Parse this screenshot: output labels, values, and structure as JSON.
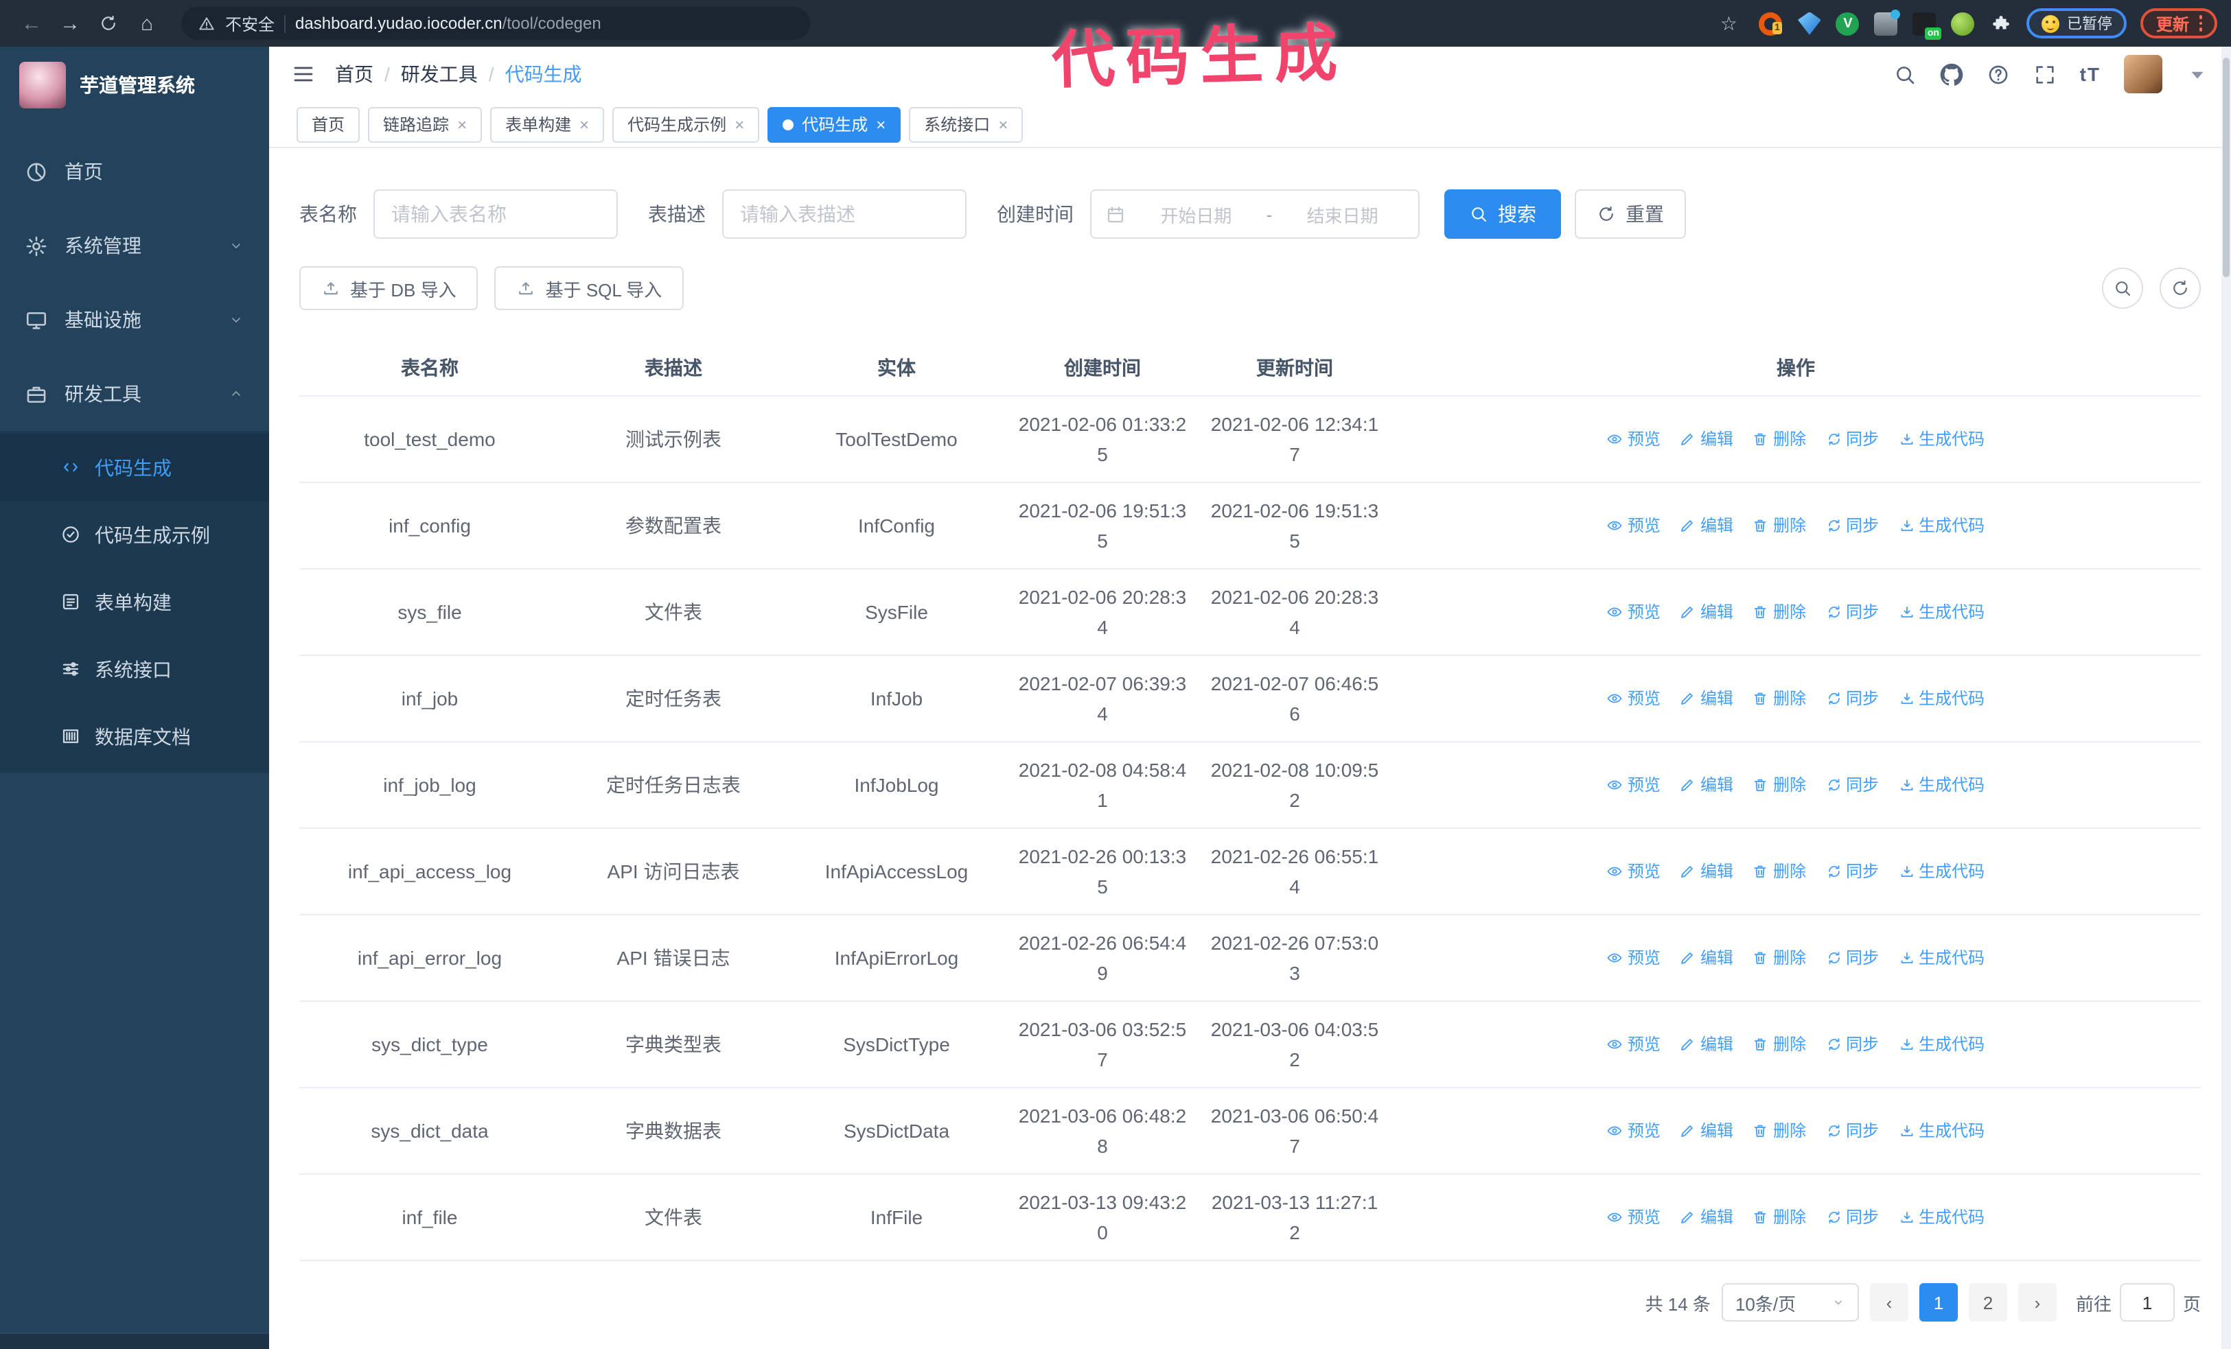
{
  "browser": {
    "security_label": "不安全",
    "url_domain": "dashboard.yudao.iocoder.cn",
    "url_path": "/tool/codegen",
    "extension_badge": "1",
    "extension_on_badge": "on",
    "paused_badge": "已暂停",
    "update_button": "更新"
  },
  "annotation": {
    "text": "代码生成",
    "color": "#f0446d"
  },
  "sidebar": {
    "app_title": "芋道管理系统",
    "items": [
      {
        "label": "首页",
        "icon": "pie-chart-icon",
        "expandable": false,
        "expanded": false
      },
      {
        "label": "系统管理",
        "icon": "gear-icon",
        "expandable": true,
        "expanded": false
      },
      {
        "label": "基础设施",
        "icon": "monitor-icon",
        "expandable": true,
        "expanded": false
      },
      {
        "label": "研发工具",
        "icon": "suitcase-icon",
        "expandable": true,
        "expanded": true
      }
    ],
    "submenu": [
      {
        "label": "代码生成",
        "icon": "code-icon",
        "active": true
      },
      {
        "label": "代码生成示例",
        "icon": "badge-check-icon",
        "active": false
      },
      {
        "label": "表单构建",
        "icon": "form-icon",
        "active": false
      },
      {
        "label": "系统接口",
        "icon": "sliders-icon",
        "active": false
      },
      {
        "label": "数据库文档",
        "icon": "table-grid-icon",
        "active": false
      }
    ]
  },
  "header": {
    "breadcrumb": [
      "首页",
      "研发工具",
      "代码生成"
    ],
    "separator": "/"
  },
  "tabs": [
    {
      "label": "首页",
      "closable": false,
      "active": false
    },
    {
      "label": "链路追踪",
      "closable": true,
      "active": false
    },
    {
      "label": "表单构建",
      "closable": true,
      "active": false
    },
    {
      "label": "代码生成示例",
      "closable": true,
      "active": false
    },
    {
      "label": "代码生成",
      "closable": true,
      "active": true
    },
    {
      "label": "系统接口",
      "closable": true,
      "active": false
    }
  ],
  "filters": {
    "name_label": "表名称",
    "name_placeholder": "请输入表名称",
    "desc_label": "表描述",
    "desc_placeholder": "请输入表描述",
    "time_label": "创建时间",
    "start_placeholder": "开始日期",
    "range_separator": "-",
    "end_placeholder": "结束日期",
    "search_button": "搜索",
    "reset_button": "重置"
  },
  "toolbar": {
    "import_db_button": "基于 DB 导入",
    "import_sql_button": "基于 SQL 导入"
  },
  "table": {
    "columns": [
      "表名称",
      "表描述",
      "实体",
      "创建时间",
      "更新时间",
      "操作"
    ],
    "actions": [
      {
        "label": "预览",
        "key": "preview",
        "icon": "eye-icon"
      },
      {
        "label": "编辑",
        "key": "edit",
        "icon": "edit-icon"
      },
      {
        "label": "删除",
        "key": "delete",
        "icon": "trash-icon"
      },
      {
        "label": "同步",
        "key": "sync",
        "icon": "sync-icon"
      },
      {
        "label": "生成代码",
        "key": "generate",
        "icon": "download-icon"
      }
    ],
    "rows": [
      {
        "name": "tool_test_demo",
        "desc": "测试示例表",
        "entity": "ToolTestDemo",
        "create_time": "2021-02-06 01:33:25",
        "update_time": "2021-02-06 12:34:17"
      },
      {
        "name": "inf_config",
        "desc": "参数配置表",
        "entity": "InfConfig",
        "create_time": "2021-02-06 19:51:35",
        "update_time": "2021-02-06 19:51:35"
      },
      {
        "name": "sys_file",
        "desc": "文件表",
        "entity": "SysFile",
        "create_time": "2021-02-06 20:28:34",
        "update_time": "2021-02-06 20:28:34"
      },
      {
        "name": "inf_job",
        "desc": "定时任务表",
        "entity": "InfJob",
        "create_time": "2021-02-07 06:39:34",
        "update_time": "2021-02-07 06:46:56"
      },
      {
        "name": "inf_job_log",
        "desc": "定时任务日志表",
        "entity": "InfJobLog",
        "create_time": "2021-02-08 04:58:41",
        "update_time": "2021-02-08 10:09:52"
      },
      {
        "name": "inf_api_access_log",
        "desc": "API 访问日志表",
        "entity": "InfApiAccessLog",
        "create_time": "2021-02-26 00:13:35",
        "update_time": "2021-02-26 06:55:14"
      },
      {
        "name": "inf_api_error_log",
        "desc": "API 错误日志",
        "entity": "InfApiErrorLog",
        "create_time": "2021-02-26 06:54:49",
        "update_time": "2021-02-26 07:53:03"
      },
      {
        "name": "sys_dict_type",
        "desc": "字典类型表",
        "entity": "SysDictType",
        "create_time": "2021-03-06 03:52:57",
        "update_time": "2021-03-06 04:03:52"
      },
      {
        "name": "sys_dict_data",
        "desc": "字典数据表",
        "entity": "SysDictData",
        "create_time": "2021-03-06 06:48:28",
        "update_time": "2021-03-06 06:50:47"
      },
      {
        "name": "inf_file",
        "desc": "文件表",
        "entity": "InfFile",
        "create_time": "2021-03-13 09:43:20",
        "update_time": "2021-03-13 11:27:12"
      }
    ]
  },
  "pagination": {
    "total_text": "共 14 条",
    "page_size": "10条/页",
    "pages": [
      "1",
      "2"
    ],
    "active_page": "1",
    "goto_label": "前往",
    "goto_value": "1",
    "goto_suffix": "页"
  },
  "colors": {
    "accent": "#2d8cf0",
    "link": "#409eff",
    "annotation": "#f0446d",
    "sidebar_bg": "#23425c",
    "chrome_bg": "#232e3a"
  }
}
